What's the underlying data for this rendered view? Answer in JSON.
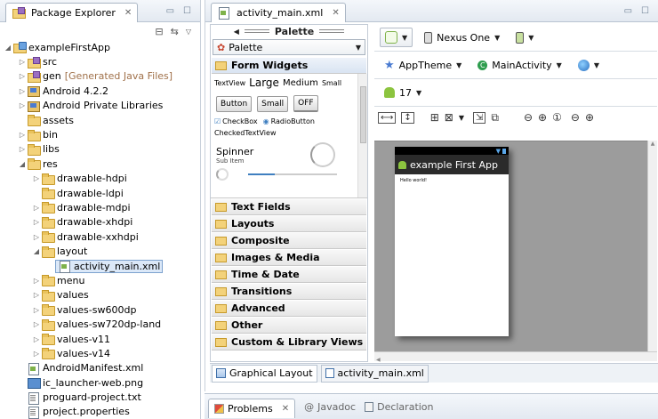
{
  "explorer": {
    "tab_label": "Package Explorer",
    "tree": [
      {
        "indent": 0,
        "twisty": "◢",
        "icon": "project",
        "label": "exampleFirstApp"
      },
      {
        "indent": 1,
        "twisty": "▷",
        "icon": "pkg",
        "label": "src"
      },
      {
        "indent": 1,
        "twisty": "▷",
        "icon": "pkg",
        "label": "gen",
        "extra": "[Generated Java Files]"
      },
      {
        "indent": 1,
        "twisty": "▷",
        "icon": "lib",
        "label": "Android 4.2.2"
      },
      {
        "indent": 1,
        "twisty": "▷",
        "icon": "lib",
        "label": "Android Private Libraries"
      },
      {
        "indent": 1,
        "twisty": "",
        "icon": "folder",
        "label": "assets"
      },
      {
        "indent": 1,
        "twisty": "▷",
        "icon": "folder",
        "label": "bin"
      },
      {
        "indent": 1,
        "twisty": "▷",
        "icon": "folder",
        "label": "libs"
      },
      {
        "indent": 1,
        "twisty": "◢",
        "icon": "folder",
        "label": "res"
      },
      {
        "indent": 2,
        "twisty": "▷",
        "icon": "folder",
        "label": "drawable-hdpi"
      },
      {
        "indent": 2,
        "twisty": "",
        "icon": "folder",
        "label": "drawable-ldpi"
      },
      {
        "indent": 2,
        "twisty": "▷",
        "icon": "folder",
        "label": "drawable-mdpi"
      },
      {
        "indent": 2,
        "twisty": "▷",
        "icon": "folder",
        "label": "drawable-xhdpi"
      },
      {
        "indent": 2,
        "twisty": "▷",
        "icon": "folder",
        "label": "drawable-xxhdpi"
      },
      {
        "indent": 2,
        "twisty": "◢",
        "icon": "folder",
        "label": "layout"
      },
      {
        "indent": 3,
        "twisty": "",
        "icon": "xml",
        "label": "activity_main.xml",
        "selected": true
      },
      {
        "indent": 2,
        "twisty": "▷",
        "icon": "folder",
        "label": "menu"
      },
      {
        "indent": 2,
        "twisty": "▷",
        "icon": "folder",
        "label": "values"
      },
      {
        "indent": 2,
        "twisty": "▷",
        "icon": "folder",
        "label": "values-sw600dp"
      },
      {
        "indent": 2,
        "twisty": "▷",
        "icon": "folder",
        "label": "values-sw720dp-land"
      },
      {
        "indent": 2,
        "twisty": "▷",
        "icon": "folder",
        "label": "values-v11"
      },
      {
        "indent": 2,
        "twisty": "▷",
        "icon": "folder",
        "label": "values-v14"
      },
      {
        "indent": 1,
        "twisty": "",
        "icon": "xml",
        "label": "AndroidManifest.xml"
      },
      {
        "indent": 1,
        "twisty": "",
        "icon": "png",
        "label": "ic_launcher-web.png"
      },
      {
        "indent": 1,
        "twisty": "",
        "icon": "txt",
        "label": "proguard-project.txt"
      },
      {
        "indent": 1,
        "twisty": "",
        "icon": "txt",
        "label": "project.properties"
      }
    ]
  },
  "editor": {
    "tab_label": "activity_main.xml",
    "palette": {
      "header": "Palette",
      "select_value": "Palette",
      "open_category": "Form Widgets",
      "textview_label": "TextView",
      "large": "Large",
      "medium": "Medium",
      "small": "Small",
      "button": "Button",
      "button_small": "Small",
      "toggle_off": "OFF",
      "checkbox": "CheckBox",
      "radio": "RadioButton",
      "checked_textview": "CheckedTextView",
      "spinner": "Spinner",
      "spinner_sub": "Sub Item",
      "categories": [
        "Text Fields",
        "Layouts",
        "Composite",
        "Images & Media",
        "Time & Date",
        "Transitions",
        "Advanced",
        "Other",
        "Custom & Library Views"
      ]
    },
    "toolbar": {
      "device": "Nexus One",
      "theme": "AppTheme",
      "activity": "MainActivity",
      "api_level": "17"
    },
    "device_preview": {
      "app_title": "example First App",
      "hello_text": "Hello world!"
    },
    "bottom_tabs": [
      "Graphical Layout",
      "activity_main.xml"
    ]
  },
  "bottom_panel": {
    "tabs": [
      "Problems",
      "Javadoc",
      "Declaration"
    ]
  },
  "colors": {
    "accent": "#3f7fc0",
    "android_green": "#8cc43f",
    "selection": "#dbe8f8"
  }
}
